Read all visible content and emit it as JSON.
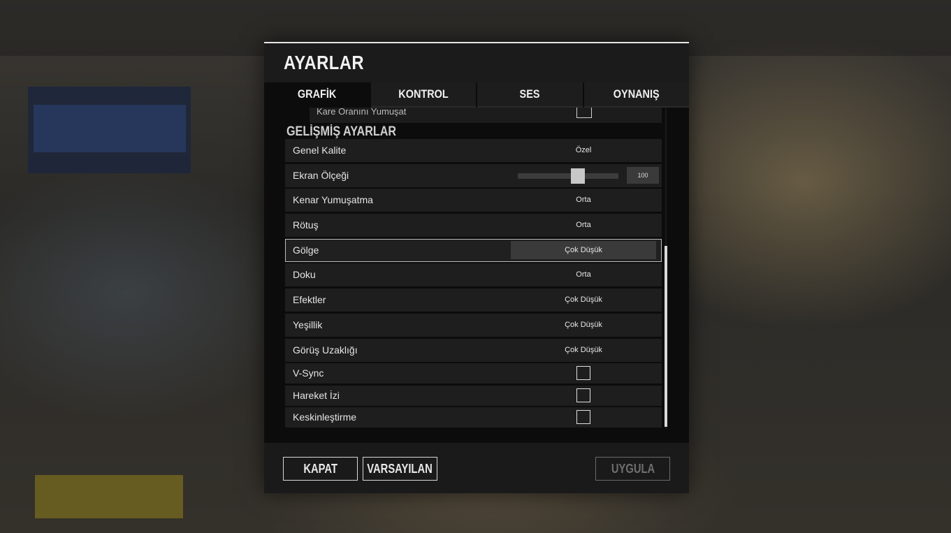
{
  "dialog": {
    "title": "AYARLAR",
    "tabs": [
      {
        "label": "GRAFİK",
        "active": true
      },
      {
        "label": "KONTROL",
        "active": false
      },
      {
        "label": "SES",
        "active": false
      },
      {
        "label": "OYNANIŞ",
        "active": false
      }
    ],
    "prev_row_label": "Kare Oranını Yumuşat",
    "section_title": "GELİŞMİŞ AYARLAR",
    "settings": [
      {
        "label": "Genel Kalite",
        "value": "Özel"
      },
      {
        "label": "Ekran Ölçeği",
        "value": "100",
        "slider_fraction": 0.6
      },
      {
        "label": "Kenar Yumuşatma",
        "value": "Orta"
      },
      {
        "label": "Rötuş",
        "value": "Orta"
      },
      {
        "label": "Gölge",
        "value": "Çok Düşük",
        "selected": true
      },
      {
        "label": "Doku",
        "value": "Orta"
      },
      {
        "label": "Efektler",
        "value": "Çok Düşük"
      },
      {
        "label": "Yeşillik",
        "value": "Çok Düşük"
      },
      {
        "label": "Görüş Uzaklığı",
        "value": "Çok Düşük"
      },
      {
        "label": "V-Sync",
        "checked": false
      },
      {
        "label": "Hareket İzi",
        "checked": false
      },
      {
        "label": "Keskinleştirme",
        "checked": false
      }
    ],
    "buttons": {
      "close": "KAPAT",
      "default": "VARSAYILAN",
      "apply": "UYGULA"
    }
  }
}
